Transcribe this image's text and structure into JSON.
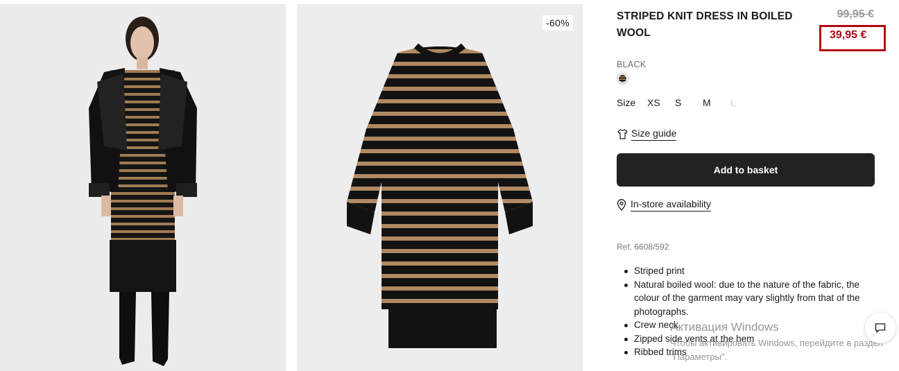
{
  "product": {
    "title": "STRIPED KNIT DRESS IN BOILED WOOL",
    "old_price": "99,95 €",
    "new_price": "39,95 €",
    "discount_badge": "-60%",
    "color_name": "BLACK",
    "size_label": "Size",
    "sizes": [
      {
        "label": "XS",
        "available": true
      },
      {
        "label": "S",
        "available": true
      },
      {
        "label": "M",
        "available": true
      },
      {
        "label": "L",
        "available": false
      }
    ],
    "size_guide": "Size guide",
    "add_to_basket": "Add to basket",
    "in_store": "In-store availability",
    "ref": "Ref. 6608/592",
    "features": [
      "Striped print",
      "Natural boiled wool: due to the nature of the fabric, the colour of the garment may vary slightly from that of the photographs.",
      "Crew neck",
      "Zipped side vents at the hem",
      "Ribbed trims"
    ]
  },
  "watermark": {
    "title": "Активация Windows",
    "subtitle": "Чтобы активировать Windows, перейдите в раздел \"Параметры\"."
  },
  "icons": {
    "swatch": "striped-swatch-icon",
    "size_guide": "tshirt-icon",
    "in_store": "location-pin-icon",
    "chat": "chat-bubble-icon"
  },
  "colors": {
    "sale_red": "#b3060f",
    "button_bg": "#222222",
    "stripe_brown": "#b58a5e"
  }
}
